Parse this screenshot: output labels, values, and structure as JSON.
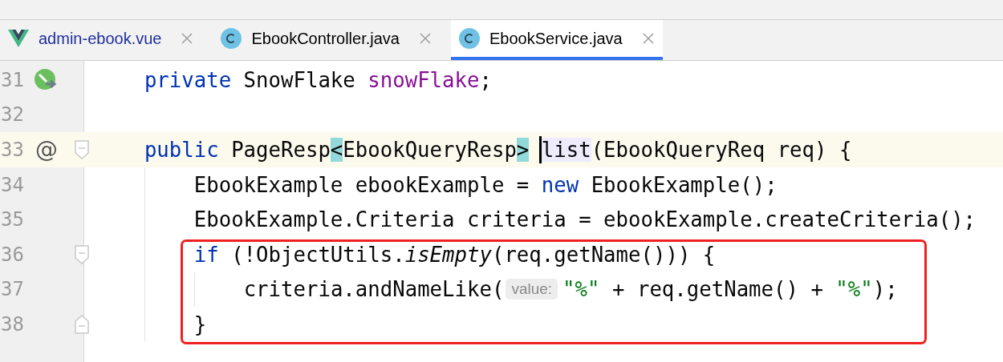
{
  "tabs": [
    {
      "kind": "vue",
      "label": "admin-ebook.vue",
      "color": "#1f2f9c",
      "selected": false
    },
    {
      "kind": "class",
      "label": "EbookController.java",
      "color": "#000000",
      "selected": false
    },
    {
      "kind": "class",
      "label": "EbookService.java",
      "color": "#000000",
      "selected": true
    }
  ],
  "editor": {
    "lines": [
      {
        "number": "31",
        "gutter_icon": {
          "kind": "bean"
        },
        "current": false,
        "boxed": false,
        "tokens": [
          {
            "kind": "keyword",
            "text": "private"
          },
          {
            "kind": "plain",
            "text": " SnowFlake "
          },
          {
            "kind": "field",
            "text": "snowFlake"
          },
          {
            "kind": "plain",
            "text": ";"
          }
        ]
      },
      {
        "number": "32",
        "current": false,
        "boxed": false
      },
      {
        "number": "33",
        "gutter_text": "@",
        "fold": {
          "kind": "start"
        },
        "current": true,
        "boxed": false,
        "tokens": [
          {
            "kind": "keyword",
            "text": "public"
          },
          {
            "kind": "plain",
            "text": " PageResp"
          },
          {
            "kind": "brace-match",
            "text": "<"
          },
          {
            "kind": "plain",
            "text": "EbookQueryResp"
          },
          {
            "kind": "brace-match",
            "text": ">"
          },
          {
            "kind": "usage",
            "text": "list",
            "caret": true
          },
          {
            "kind": "plain",
            "text": "(EbookQueryReq req) {"
          }
        ],
        "children": [
          {
            "number": "34",
            "current": false,
            "boxed": false,
            "tokens": [
              {
                "kind": "plain",
                "text": "EbookExample ebookExample = "
              },
              {
                "kind": "keyword",
                "text": "new"
              },
              {
                "kind": "plain",
                "text": " EbookExample();"
              }
            ]
          },
          {
            "number": "35",
            "current": false,
            "boxed": false,
            "tokens": [
              {
                "kind": "plain",
                "text": "EbookExample.Criteria criteria = ebookExample.createCriteria();"
              }
            ]
          },
          {
            "number": "36",
            "fold": {
              "kind": "start"
            },
            "current": false,
            "boxed": true,
            "tokens": [
              {
                "kind": "keyword",
                "text": "if"
              },
              {
                "kind": "plain",
                "text": " (!ObjectUtils."
              },
              {
                "kind": "italic",
                "text": "isEmpty"
              },
              {
                "kind": "plain",
                "text": "(req.getName())) {"
              }
            ],
            "children": [
              {
                "number": "37",
                "current": false,
                "boxed": true,
                "tokens": [
                  {
                    "kind": "plain",
                    "text": "criteria.andNameLike("
                  },
                  {
                    "kind": "hint",
                    "text": "value:"
                  },
                  {
                    "kind": "string",
                    "text": "\"%\""
                  },
                  {
                    "kind": "plain",
                    "text": " + req.getName() + "
                  },
                  {
                    "kind": "string",
                    "text": "\"%\""
                  },
                  {
                    "kind": "plain",
                    "text": ");"
                  }
                ]
              }
            ]
          },
          {
            "number": "38",
            "fold": {
              "kind": "end"
            },
            "current": false,
            "boxed": true,
            "tokens": [
              {
                "kind": "plain",
                "text": "}"
              }
            ]
          }
        ]
      }
    ]
  }
}
